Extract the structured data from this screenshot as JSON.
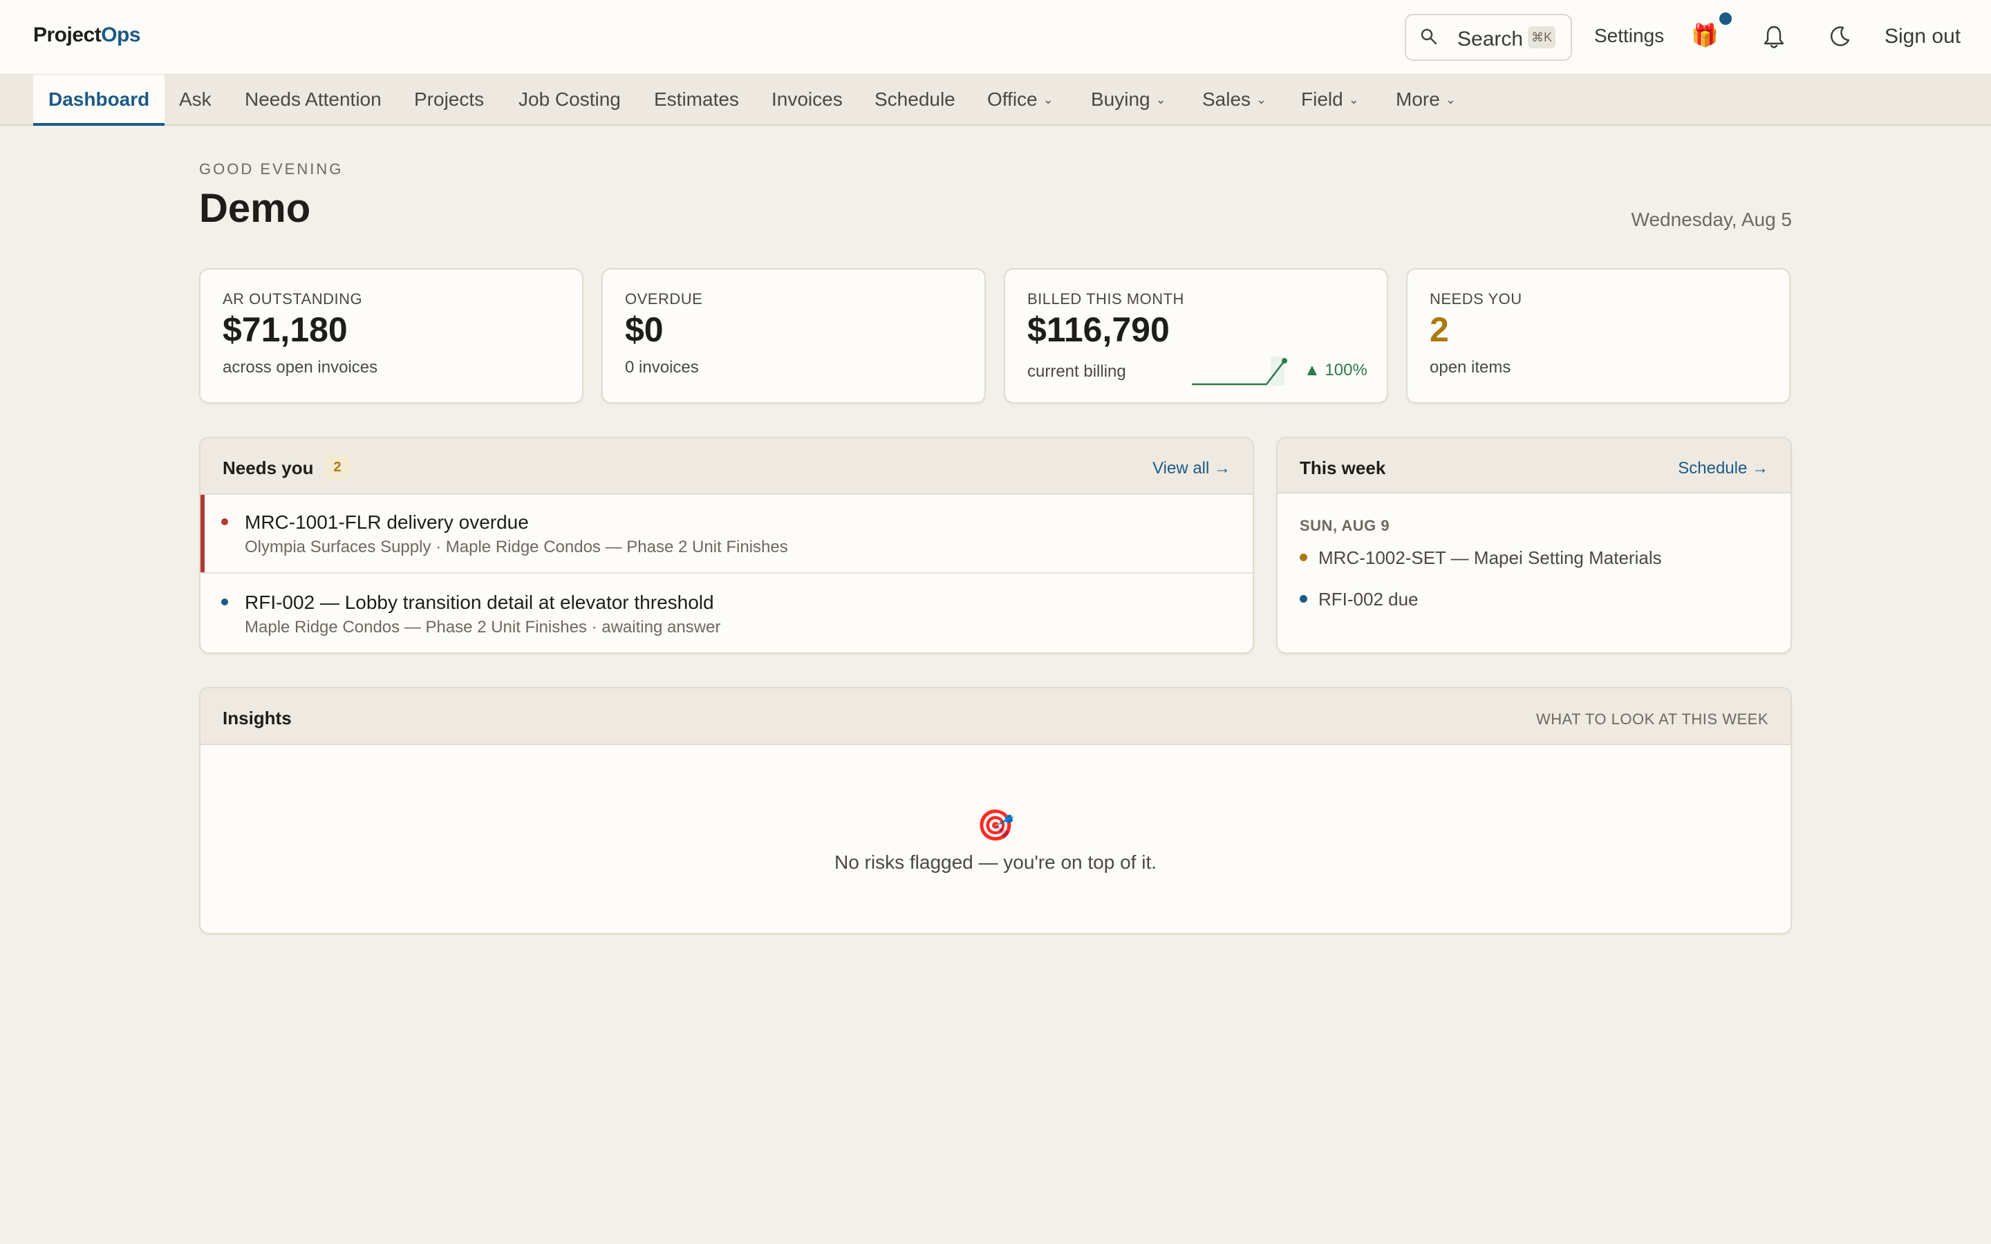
{
  "app": {
    "logo_main": "Project",
    "logo_accent": "Ops"
  },
  "header": {
    "search_label": "Search",
    "search_shortcut": "⌘K",
    "settings_label": "Settings",
    "sign_out_label": "Sign out",
    "icons": [
      "search-icon",
      "gift-icon",
      "bell-icon",
      "moon-icon"
    ]
  },
  "nav": {
    "items": [
      {
        "label": "Dashboard",
        "active": true
      },
      {
        "label": "Ask"
      },
      {
        "label": "Needs Attention"
      },
      {
        "label": "Projects"
      },
      {
        "label": "Job Costing"
      },
      {
        "label": "Estimates"
      },
      {
        "label": "Invoices"
      },
      {
        "label": "Schedule"
      },
      {
        "label": "Office",
        "dropdown": true
      },
      {
        "label": "Buying",
        "dropdown": true
      },
      {
        "label": "Sales",
        "dropdown": true
      },
      {
        "label": "Field",
        "dropdown": true
      },
      {
        "label": "More",
        "dropdown": true
      }
    ]
  },
  "greeting": {
    "kicker": "GOOD EVENING",
    "name": "Demo",
    "date": "Wednesday, Aug 5"
  },
  "stats": {
    "ar": {
      "label": "AR OUTSTANDING",
      "value": "$71,180",
      "sub": "across open invoices"
    },
    "overdue": {
      "label": "OVERDUE",
      "value": "$0",
      "sub": "0 invoices"
    },
    "billed": {
      "label": "BILLED THIS MONTH",
      "value": "$116,790",
      "sub": "current billing",
      "trend": "▲ 100%"
    },
    "needs": {
      "label": "NEEDS YOU",
      "value": "2",
      "sub": "open items"
    }
  },
  "needs_you": {
    "title": "Needs you",
    "count": "2",
    "link": "View all →",
    "items": [
      {
        "title": "MRC-1001-FLR delivery overdue",
        "meta": "Olympia Surfaces Supply · Maple Ridge Condos — Phase 2 Unit Finishes"
      },
      {
        "title": "RFI-002 — Lobby transition detail at elevator threshold",
        "meta": "Maple Ridge Condos — Phase 2 Unit Finishes · awaiting answer"
      }
    ]
  },
  "this_week": {
    "title": "This week",
    "link": "Schedule →",
    "day": "SUN, AUG 9",
    "items": [
      {
        "label": "MRC-1002-SET — Mapei Setting Materials"
      },
      {
        "label": "RFI-002 due"
      }
    ]
  },
  "insights": {
    "title": "Insights",
    "note": "WHAT TO LOOK AT THIS WEEK",
    "empty_icon": "🎯",
    "empty_text": "No risks flagged — you're on top of it."
  },
  "colors": {
    "accent": "#1c5a86",
    "danger": "#b23a34",
    "warning": "#a97a14",
    "success": "#2c7a4b",
    "background": "#f3f0ea"
  }
}
